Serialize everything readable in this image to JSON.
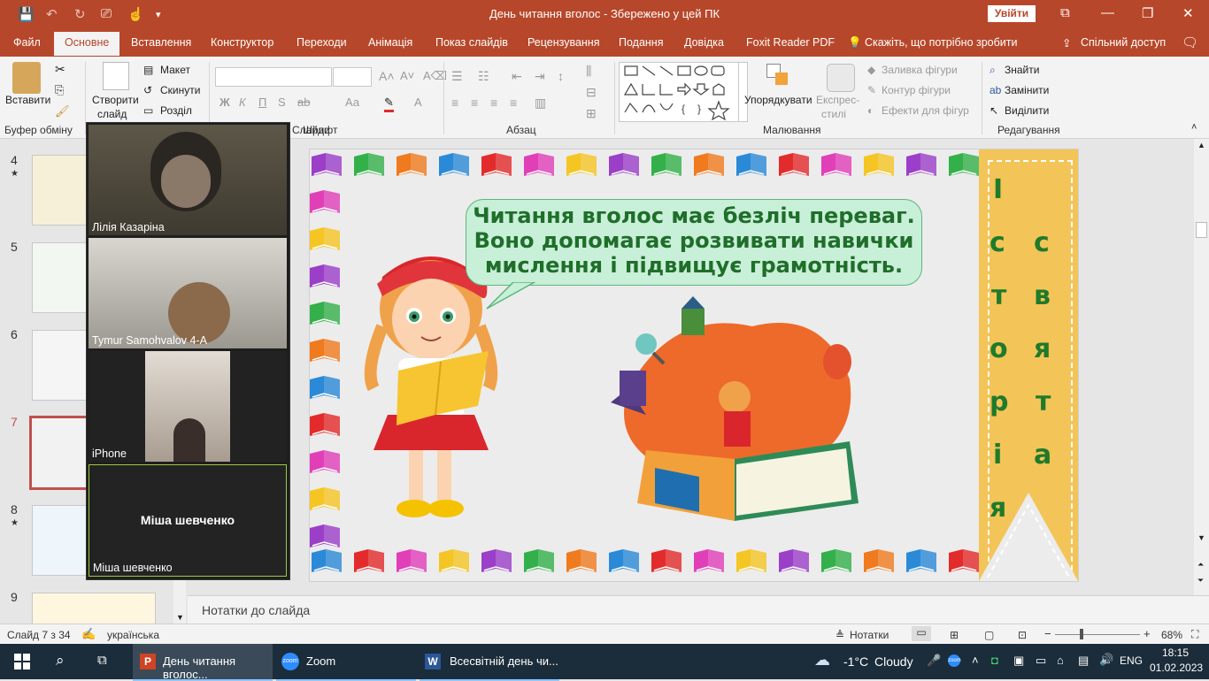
{
  "titlebar": {
    "title": "День читання вголос  -  Збережено у цей ПК",
    "signin": "Увійти",
    "qa_save": "💾",
    "qa_undo": "↶",
    "qa_redo": "↻",
    "qa_present": "⎚",
    "qa_touch": "☝",
    "qa_more": "▾",
    "win_ribbon": "⧉",
    "win_min": "—",
    "win_max": "❐",
    "win_close": "✕"
  },
  "tabs": [
    "Файл",
    "Основне",
    "Вставлення",
    "Конструктор",
    "Переходи",
    "Анімація",
    "Показ слайдів",
    "Рецензування",
    "Подання",
    "Довідка",
    "Foxit Reader PDF"
  ],
  "tell_me": "Скажіть, що потрібно зробити",
  "share": "Спільний доступ",
  "ribbon": {
    "paste": "Вставити",
    "new_slide_1": "Створити",
    "new_slide_2": "слайд",
    "layout": "Макет",
    "reset": "Скинути",
    "section": "Розділ",
    "font_bold": "Ж",
    "font_italic": "К",
    "font_underline": "П",
    "font_strike": "S",
    "font_spacing": "ab",
    "font_case": "Аа",
    "font_color": "А",
    "arrange": "Упорядкувати",
    "quick_styles_1": "Експрес-",
    "quick_styles_2": "стилі",
    "shape_fill": "Заливка фігури",
    "shape_outline": "Контур фігури",
    "shape_effects": "Ефекти для фігур",
    "find": "Знайти",
    "replace": "Замінити",
    "select": "Виділити",
    "groups": {
      "clipboard": "Буфер обміну",
      "slides": "Слайди",
      "font": "Шрифт",
      "paragraph": "Абзац",
      "drawing": "Малювання",
      "editing": "Редагування"
    }
  },
  "thumbnails": [
    {
      "num": "4",
      "star": "★"
    },
    {
      "num": "5",
      "star": ""
    },
    {
      "num": "6",
      "star": ""
    },
    {
      "num": "7",
      "star": ""
    },
    {
      "num": "8",
      "star": "★"
    },
    {
      "num": "9",
      "star": ""
    }
  ],
  "video": [
    {
      "name": "Лілія Казаріна"
    },
    {
      "name": "Tymur Samohvalov 4-A"
    },
    {
      "name": "iPhone"
    },
    {
      "name": "Міша шевченко",
      "center_label": "Міша шевченко"
    }
  ],
  "slide": {
    "bubble_text": "Читання вголос має безліч переваг. Воно допомагає розвивати навички мислення і підвищує грамотність.",
    "banner_left": [
      "І",
      "с",
      "т",
      "о",
      "р",
      "і",
      "я"
    ],
    "banner_right": [
      "с",
      "в",
      "я",
      "т",
      "а"
    ]
  },
  "notes": {
    "label": "Нотатки до слайда"
  },
  "status": {
    "slide_of": "Слайд 7 з 34",
    "language": "українська",
    "notes_btn": "Нотатки",
    "zoom": "68%",
    "zoom_minus": "−",
    "zoom_plus": "+"
  },
  "taskbar": {
    "apps": [
      {
        "label": "День читання вголос...",
        "icon": "P"
      },
      {
        "label": "Zoom",
        "icon": "zoom"
      },
      {
        "label": "Всесвітній день чи...",
        "icon": "W"
      }
    ],
    "weather_temp": "-1°C",
    "weather_text": "Cloudy",
    "lang": "ENG",
    "time": "18:15",
    "date": "01.02.2023"
  },
  "colors": {
    "accent": "#b7472a",
    "bubble_text": "#1f6e2a",
    "banner": "#f3c458",
    "taskbar": "#1b2c3a"
  }
}
